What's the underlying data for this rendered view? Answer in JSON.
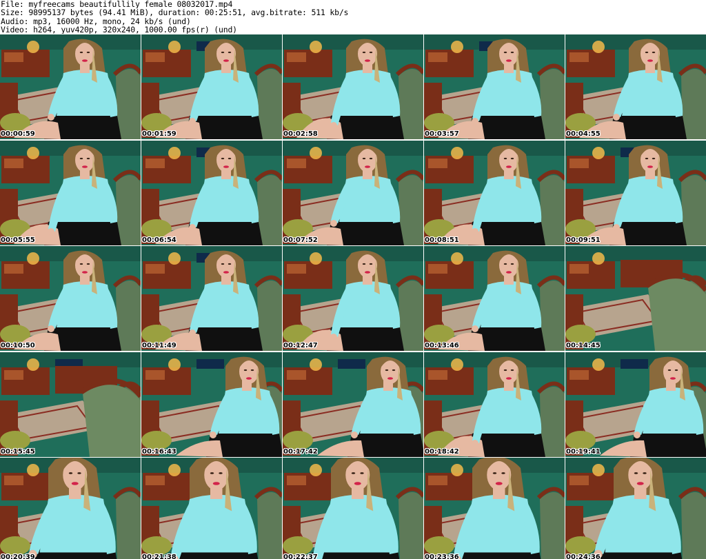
{
  "header": {
    "file_line": "File: myfreecams_beautifullily_female_08032017.mp4",
    "size_line": "Size: 98995137 bytes (94.41 MiB), duration: 00:25:51, avg.bitrate: 511 kb/s",
    "audio_line": "Audio: mp3, 16000 Hz, mono, 24 kb/s (und)",
    "video_line": "Video: h264, yuv420p, 320x240, 1000.00 fps(r) (und)"
  },
  "grid": {
    "columns": 5,
    "rows": 5
  },
  "colors": {
    "wall": "#1f6e5a",
    "wall_dark": "#154a3e",
    "wood": "#7a2e18",
    "rug": "#b7a48e",
    "chair": "#9aa040",
    "top": "#8fe6ea",
    "skirt": "#101010",
    "skin": "#e6b9a2",
    "hair": "#8a6a3c"
  },
  "frames": [
    {
      "timestamp": "00:00:59",
      "scene": "person",
      "pose": 0
    },
    {
      "timestamp": "00:01:59",
      "scene": "person",
      "pose": 1
    },
    {
      "timestamp": "00:02:58",
      "scene": "person",
      "pose": 2
    },
    {
      "timestamp": "00:03:57",
      "scene": "person",
      "pose": 1
    },
    {
      "timestamp": "00:04:55",
      "scene": "person",
      "pose": 0
    },
    {
      "timestamp": "00:05:55",
      "scene": "person",
      "pose": 2
    },
    {
      "timestamp": "00:06:54",
      "scene": "person",
      "pose": 1
    },
    {
      "timestamp": "00:07:52",
      "scene": "person",
      "pose": 0
    },
    {
      "timestamp": "00:08:51",
      "scene": "person",
      "pose": 2
    },
    {
      "timestamp": "00:09:51",
      "scene": "person",
      "pose": 1
    },
    {
      "timestamp": "00:10:50",
      "scene": "person",
      "pose": 0
    },
    {
      "timestamp": "00:11:49",
      "scene": "person",
      "pose": 1
    },
    {
      "timestamp": "00:12:47",
      "scene": "person",
      "pose": 2
    },
    {
      "timestamp": "00:13:46",
      "scene": "person",
      "pose": 0
    },
    {
      "timestamp": "00:14:45",
      "scene": "room",
      "pose": 0
    },
    {
      "timestamp": "00:15:45",
      "scene": "room",
      "pose": 1
    },
    {
      "timestamp": "00:16:43",
      "scene": "person",
      "pose": 3
    },
    {
      "timestamp": "00:17:42",
      "scene": "person",
      "pose": 3
    },
    {
      "timestamp": "00:18:42",
      "scene": "person",
      "pose": 2
    },
    {
      "timestamp": "00:19:41",
      "scene": "person",
      "pose": 3
    },
    {
      "timestamp": "00:20:39",
      "scene": "closeup",
      "pose": 0
    },
    {
      "timestamp": "00:21:38",
      "scene": "closeup",
      "pose": 1
    },
    {
      "timestamp": "00:22:37",
      "scene": "closeup",
      "pose": 2
    },
    {
      "timestamp": "00:23:36",
      "scene": "closeup",
      "pose": 1
    },
    {
      "timestamp": "00:24:36",
      "scene": "closeup",
      "pose": 0
    }
  ]
}
